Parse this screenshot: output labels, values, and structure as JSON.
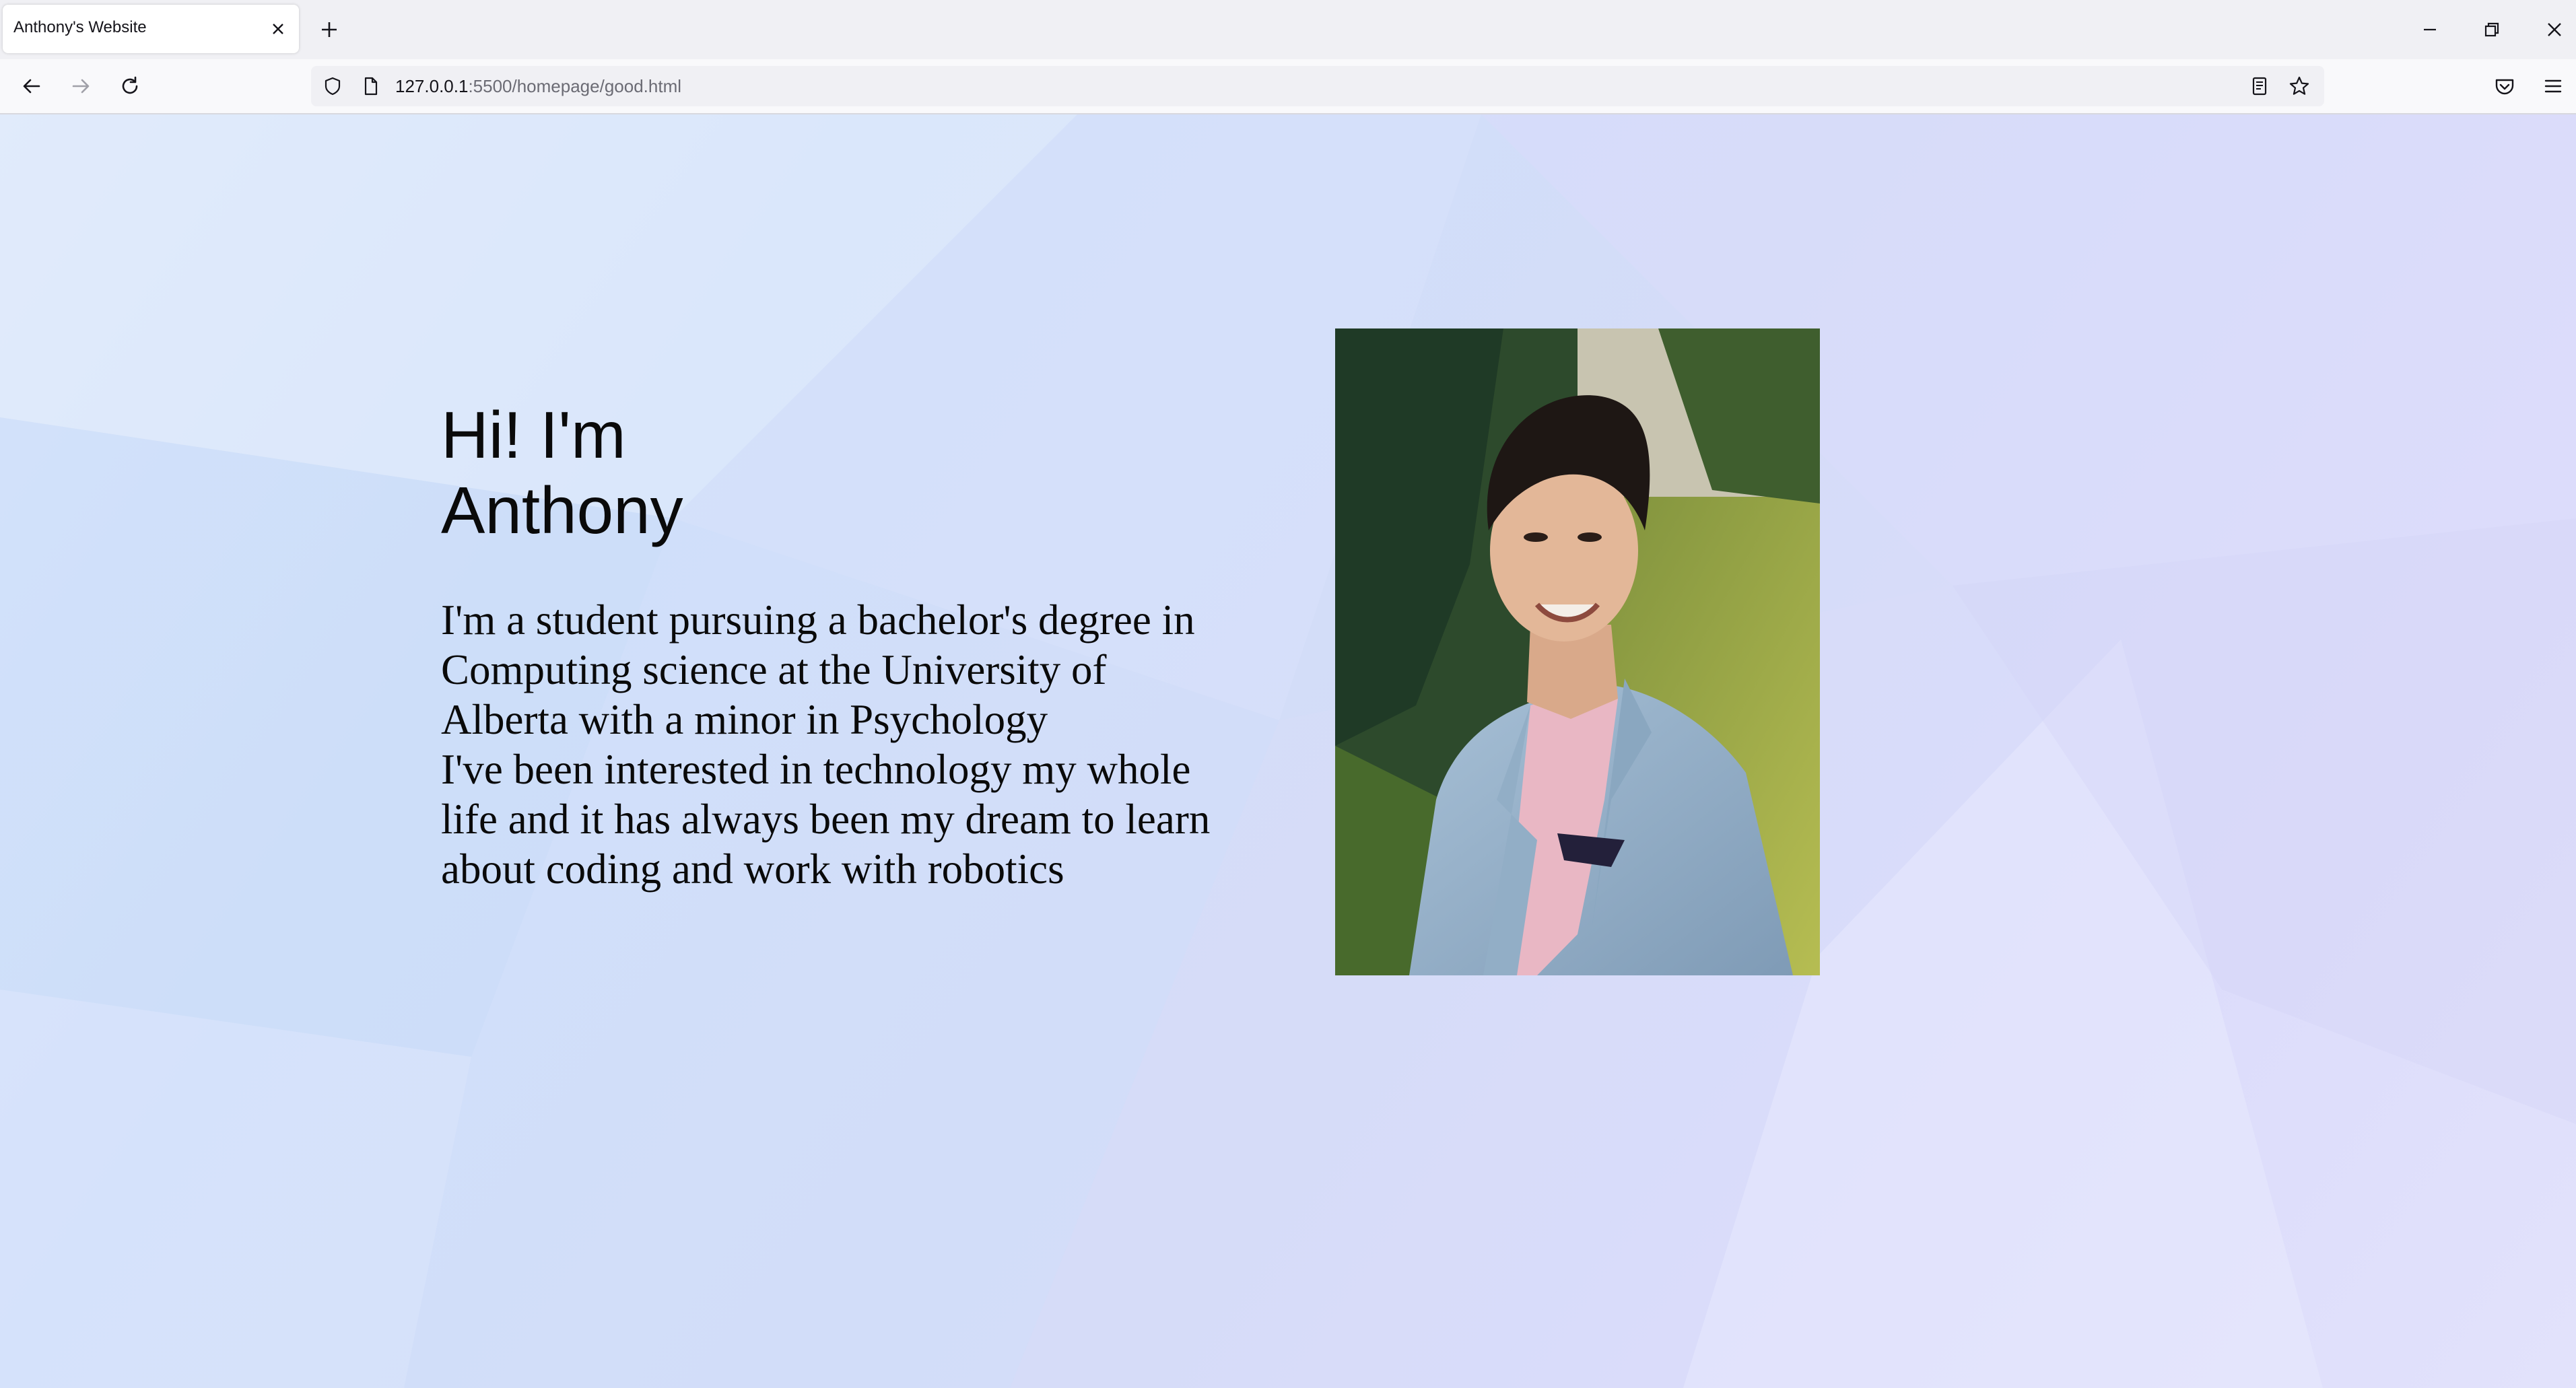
{
  "browser": {
    "tab": {
      "title": "Anthony's Website"
    },
    "url": {
      "host": "127.0.0.1",
      "rest": ":5500/homepage/good.html"
    }
  },
  "page": {
    "heading": {
      "line1": "Hi! I'm",
      "line2": "Anthony"
    },
    "bio_lines": [
      "I'm a student pursuing a bachelor's degree in",
      "Computing science at the University of",
      "Alberta with a minor in Psychology",
      "I've been interested in technology my whole",
      "life and it has always been my dream to learn",
      "about coding and work with robotics"
    ]
  },
  "colors": {
    "tabstrip": "#f0f0f4",
    "navbar": "#f9f9fb",
    "text": "#0a0a0a"
  }
}
